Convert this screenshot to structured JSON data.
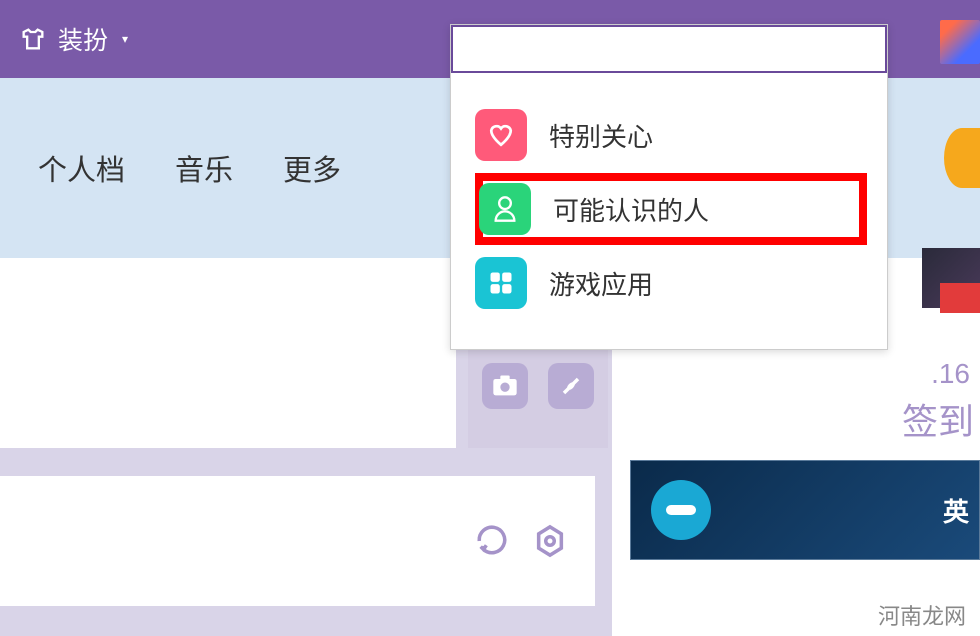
{
  "header": {
    "dress_label": "装扮",
    "dress_icon": "tshirt-icon"
  },
  "nav": {
    "items": [
      "个人档",
      "音乐",
      "更多"
    ]
  },
  "dropdown": {
    "search_value": "",
    "items": [
      {
        "icon": "heart-icon",
        "label": "特别关心"
      },
      {
        "icon": "person-icon",
        "label": "可能认识的人"
      },
      {
        "icon": "apps-icon",
        "label": "游戏应用"
      }
    ]
  },
  "sidebar": {
    "date_fragment": ".16",
    "checkin_label": "签到"
  },
  "banner": {
    "text_fragment": "英"
  },
  "watermark": "河南龙网",
  "colors": {
    "header_bg": "#7a5aa8",
    "nav_bg": "#d4e4f3",
    "accent_purple": "#a593c9",
    "highlight_red": "#ff0000",
    "heart_bg": "#ff5a7a",
    "person_bg": "#2ad47a",
    "apps_bg": "#1ac4d4"
  }
}
